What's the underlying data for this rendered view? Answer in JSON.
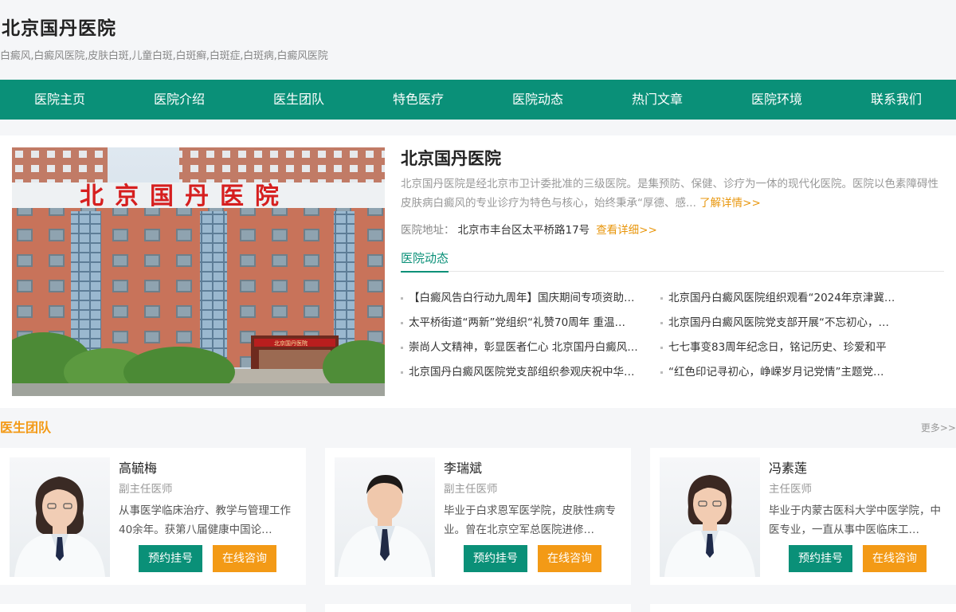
{
  "header": {
    "title": "北京国丹医院",
    "keywords": "白癜风,白癜风医院,皮肤白斑,儿童白斑,白斑癣,白斑症,白斑病,白癜风医院"
  },
  "nav": [
    "医院主页",
    "医院介绍",
    "医生团队",
    "特色医疗",
    "医院动态",
    "热门文章",
    "医院环境",
    "联系我们"
  ],
  "intro": {
    "image_sign": "北京国丹医院",
    "image_small_sign": "北京国丹医院",
    "title": "北京国丹医院",
    "description": "北京国丹医院是经北京市卫计委批准的三级医院。是集预防、保健、诊疗为一体的现代化医院。医院以色素障碍性皮肤病白癜风的专业诊疗为特色与核心，始终秉承“厚德、感...",
    "desc_more": "了解详情>>",
    "address_label": "医院地址：",
    "address": "北京市丰台区太平桥路17号",
    "address_more": "查看详细>>",
    "news_tab": "医院动态",
    "news": [
      "【白癜风告白行动九周年】国庆期间专项资助…",
      "北京国丹白癜风医院组织观看“2024年京津冀…",
      "太平桥街道“两新”党组织“礼赞70周年 重温…",
      "北京国丹白癜风医院党支部开展“不忘初心，…",
      "崇尚人文精神，彰显医者仁心 北京国丹白癜风…",
      "七七事变83周年纪念日，铭记历史、珍爱和平",
      "北京国丹白癜风医院党支部组织参观庆祝中华…",
      "“红色印记寻初心，峥嵘岁月记党情”主题党…"
    ]
  },
  "doctors_section": {
    "title": "医生团队",
    "more": "更多>>"
  },
  "doctors": [
    {
      "name": "高毓梅",
      "title": "副主任医师",
      "desc": "从事医学临床治疗、教学与管理工作40余年。获第八届健康中国论…",
      "book": "预约挂号",
      "consult": "在线咨询"
    },
    {
      "name": "李瑞斌",
      "title": "副主任医师",
      "desc": "毕业于白求恩军医学院，皮肤性病专业。曾在北京空军总医院进修…",
      "book": "预约挂号",
      "consult": "在线咨询"
    },
    {
      "name": "冯素莲",
      "title": "主任医师",
      "desc": "毕业于内蒙古医科大学中医学院，中医专业，一直从事中医临床工…",
      "book": "预约挂号",
      "consult": "在线咨询"
    }
  ],
  "colors": {
    "brand_green": "#0a9078",
    "accent_orange": "#f39a16",
    "background": "#f5f6f8"
  }
}
